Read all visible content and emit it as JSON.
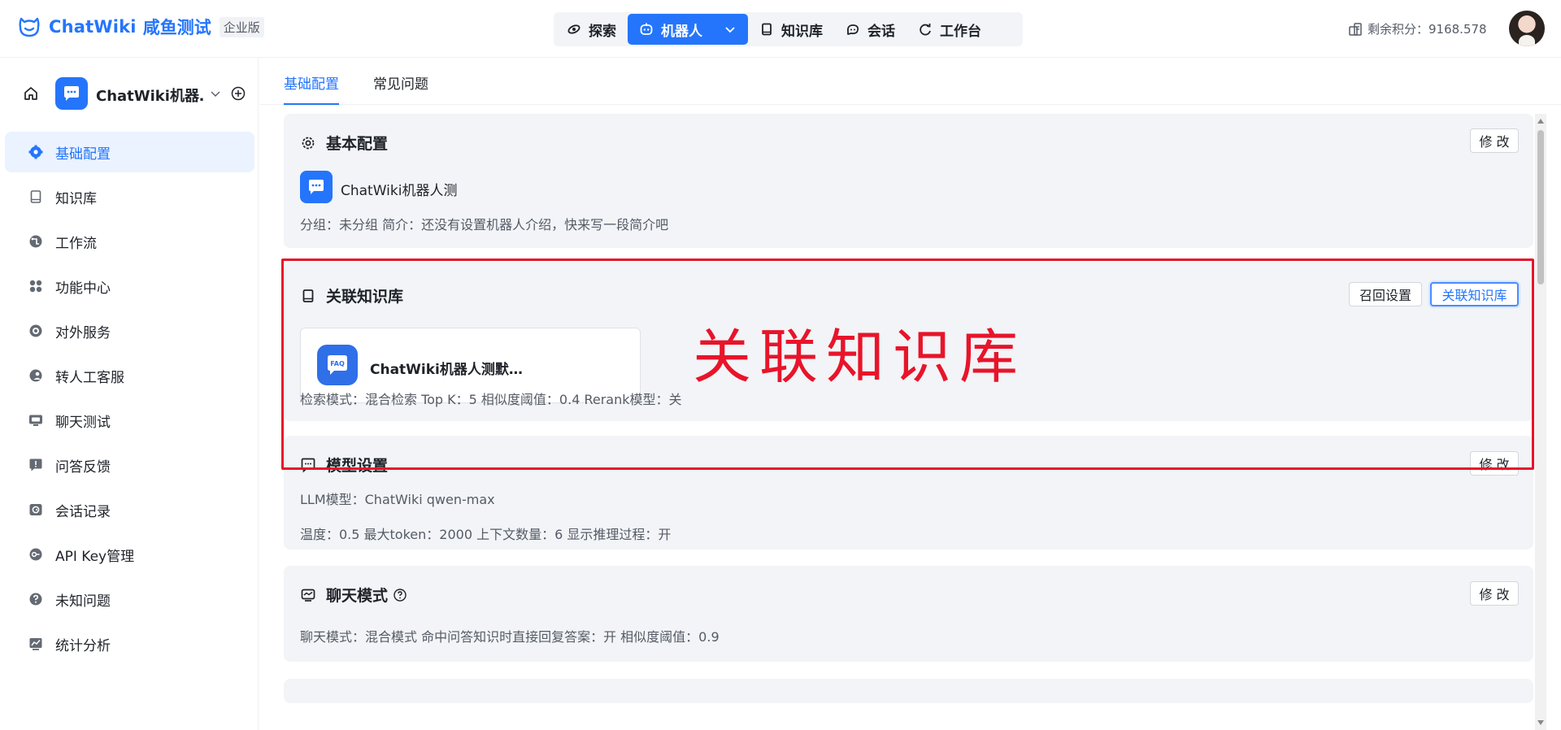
{
  "header": {
    "logo_text": "ChatWiki",
    "logo_sub": "咸鱼测试",
    "edition_badge": "企业版",
    "nav": [
      {
        "label": "探索",
        "icon": "explore-icon"
      },
      {
        "label": "机器人",
        "icon": "robot-icon"
      },
      {
        "label": "知识库",
        "icon": "book-icon"
      },
      {
        "label": "会话",
        "icon": "chat-icon"
      },
      {
        "label": "工作台",
        "icon": "workbench-icon"
      }
    ],
    "points_label": "剩余积分：9168.578"
  },
  "sidebar": {
    "robot_name": "ChatWiki机器…",
    "menu": [
      {
        "label": "基础配置",
        "icon": "gear-icon"
      },
      {
        "label": "知识库",
        "icon": "book-icon"
      },
      {
        "label": "工作流",
        "icon": "workflow-icon"
      },
      {
        "label": "功能中心",
        "icon": "apps-icon"
      },
      {
        "label": "对外服务",
        "icon": "service-icon"
      },
      {
        "label": "转人工客服",
        "icon": "agent-icon"
      },
      {
        "label": "聊天测试",
        "icon": "chat-test-icon"
      },
      {
        "label": "问答反馈",
        "icon": "feedback-icon"
      },
      {
        "label": "会话记录",
        "icon": "record-icon"
      },
      {
        "label": "API Key管理",
        "icon": "api-key-icon"
      },
      {
        "label": "未知问题",
        "icon": "question-icon"
      },
      {
        "label": "统计分析",
        "icon": "stats-icon"
      }
    ]
  },
  "tabs": [
    "基础配置",
    "常见问题"
  ],
  "basic": {
    "title": "基本配置",
    "edit": "修 改",
    "robot_name": "ChatWiki机器人测",
    "meta": "分组：未分组  简介：还没有设置机器人介绍，快来写一段简介吧"
  },
  "kb": {
    "title": "关联知识库",
    "recall_btn": "召回设置",
    "link_btn": "关联知识库",
    "item_name": "ChatWiki机器人测默…",
    "item_icon_text": "FAQ",
    "meta": "检索模式：混合检索    Top K：5    相似度阈值：0.4    Rerank模型：关",
    "annotation": "关联知识库"
  },
  "model": {
    "title": "模型设置",
    "edit": "修 改",
    "llm": "LLM模型：ChatWiki qwen-max",
    "params": "温度：0.5    最大token：2000    上下文数量：6    显示推理过程：开"
  },
  "chat_mode": {
    "title": "聊天模式",
    "edit": "修 改",
    "meta": "聊天模式：混合模式    命中问答知识时直接回复答案：开    相似度阈值：0.9"
  },
  "colors": {
    "primary": "#2475fc",
    "annotation_red": "#e8142a",
    "card_bg": "#f2f4f7"
  }
}
